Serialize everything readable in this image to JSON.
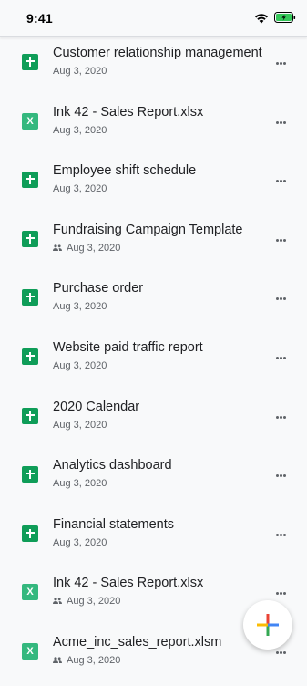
{
  "status_bar": {
    "time": "9:41",
    "wifi_icon": "wifi-icon",
    "battery_icon": "battery-charging-icon"
  },
  "files": [
    {
      "name": "Customer relationship management",
      "date": "Aug 3, 2020",
      "type": "sheets",
      "shared": false
    },
    {
      "name": "Ink 42 - Sales Report.xlsx",
      "date": "Aug 3, 2020",
      "type": "excel",
      "shared": false
    },
    {
      "name": "Employee shift schedule",
      "date": "Aug 3, 2020",
      "type": "sheets",
      "shared": false
    },
    {
      "name": "Fundraising Campaign Template",
      "date": "Aug 3, 2020",
      "type": "sheets",
      "shared": true
    },
    {
      "name": "Purchase order",
      "date": "Aug 3, 2020",
      "type": "sheets",
      "shared": false
    },
    {
      "name": "Website paid traffic report",
      "date": "Aug 3, 2020",
      "type": "sheets",
      "shared": false
    },
    {
      "name": "2020 Calendar",
      "date": "Aug 3, 2020",
      "type": "sheets",
      "shared": false
    },
    {
      "name": "Analytics dashboard",
      "date": "Aug 3, 2020",
      "type": "sheets",
      "shared": false
    },
    {
      "name": "Financial statements",
      "date": "Aug 3, 2020",
      "type": "sheets",
      "shared": false
    },
    {
      "name": "Ink 42 - Sales Report.xlsx",
      "date": "Aug 3, 2020",
      "type": "excel",
      "shared": true
    },
    {
      "name": "Acme_inc_sales_report.xlsm",
      "date": "Aug 3, 2020",
      "type": "excel",
      "shared": true
    }
  ],
  "icons": {
    "sheets_file_icon": "google-sheets-icon",
    "excel_file_icon": "excel-file-icon",
    "excel_letter": "X",
    "shared_icon": "people-icon",
    "more_icon": "more-horizontal-icon",
    "fab_icon": "plus-multicolor-icon"
  },
  "colors": {
    "sheets_green": "#0f9d58",
    "excel_green": "#34b87e",
    "background": "#f8f9fa",
    "fab_blue": "#4285f4",
    "fab_red": "#ea4335",
    "fab_yellow": "#fbbc04",
    "fab_green": "#34a853",
    "battery_green": "#34c759"
  }
}
